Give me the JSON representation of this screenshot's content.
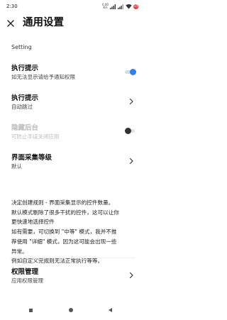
{
  "status_bar": {
    "time": "2:30",
    "network_speed_value": "0.00",
    "network_speed_unit": "K/s",
    "battery_level": "35"
  },
  "header": {
    "close_icon": "close-icon",
    "title": "通用设置"
  },
  "section": {
    "label": "Setting"
  },
  "rows": [
    {
      "title": "执行提示",
      "subtitle": "如无法显示请给予通知权限",
      "control": "toggle",
      "state": "on",
      "enabled": true
    },
    {
      "title": "执行提示",
      "subtitle": "自动跳过",
      "control": "chevron",
      "enabled": true
    },
    {
      "title": "隐藏后台",
      "subtitle": "可防止手误关闭应用",
      "control": "toggle",
      "state": "off",
      "enabled": false
    },
    {
      "title": "界面采集等级",
      "subtitle": "默认",
      "control": "chevron",
      "enabled": true
    }
  ],
  "description_lines": [
    "决定创建规则 - 界面采集显示的控件数量。",
    "默认模式剔除了很多干扰的控件，这可以让你",
    "更快速地选择控件",
    "如有需要，可切换到 \"中等\" 模式，我并不推",
    "荐使用 \"详细\" 模式，因为这可能会出现一些",
    "异常。",
    "例如自定义完规则无法正常执行等等。"
  ],
  "permission_row": {
    "title": "权限管理",
    "subtitle": "应用权限管理",
    "control": "chevron"
  },
  "colors": {
    "toggle_on_knob": "#2f80ed",
    "toggle_on_track": "#c9dcf6",
    "toggle_off_knob": "#333333",
    "toggle_off_track": "#e2e2e2",
    "battery_badge": "#e23b3b"
  },
  "nav_bar": {
    "icons": [
      "recents-square-icon",
      "home-circle-icon",
      "back-triangle-icon"
    ]
  }
}
